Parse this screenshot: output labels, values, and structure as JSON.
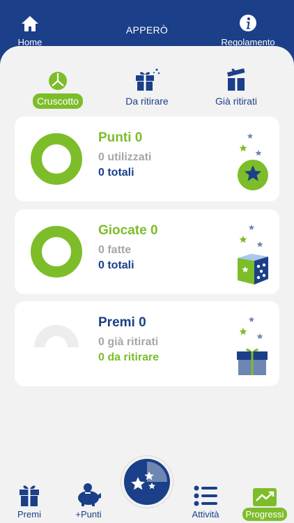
{
  "header": {
    "home_label": "Home",
    "title": "APPERÒ",
    "rules_label": "Regolamento"
  },
  "tabs": [
    {
      "label": "Cruscotto",
      "icon": "pie-chart-icon",
      "active": true
    },
    {
      "label": "Da ritirare",
      "icon": "gift-sparkle-icon",
      "active": false
    },
    {
      "label": "Già ritirati",
      "icon": "gift-open-icon",
      "active": false
    }
  ],
  "cards": [
    {
      "title": "Punti 0",
      "line1": "0 utilizzati",
      "line2": "0 totali",
      "progress": 1.0,
      "icon": "star-badge-icon"
    },
    {
      "title": "Giocate 0",
      "line1": "0 fatte",
      "line2": "0 totali",
      "progress": 1.0,
      "icon": "dice-icon"
    },
    {
      "title": "Premi 0",
      "line1": "0 già ritirati",
      "line2": "0 da ritirare",
      "progress": 0.0,
      "icon": "gift-box-icon"
    }
  ],
  "bottom_nav": [
    {
      "label": "Premi",
      "icon": "gift-icon",
      "active": false
    },
    {
      "label": "+Punti",
      "icon": "piggy-bank-icon",
      "active": false
    },
    {
      "label": "Attività",
      "icon": "list-icon",
      "active": false
    },
    {
      "label": "Progressi",
      "icon": "trend-chart-icon",
      "active": true
    }
  ],
  "colors": {
    "primary": "#1b3f88",
    "accent": "#7dbd2a",
    "muted": "#a6a6a6",
    "background": "#f2f2f3"
  }
}
